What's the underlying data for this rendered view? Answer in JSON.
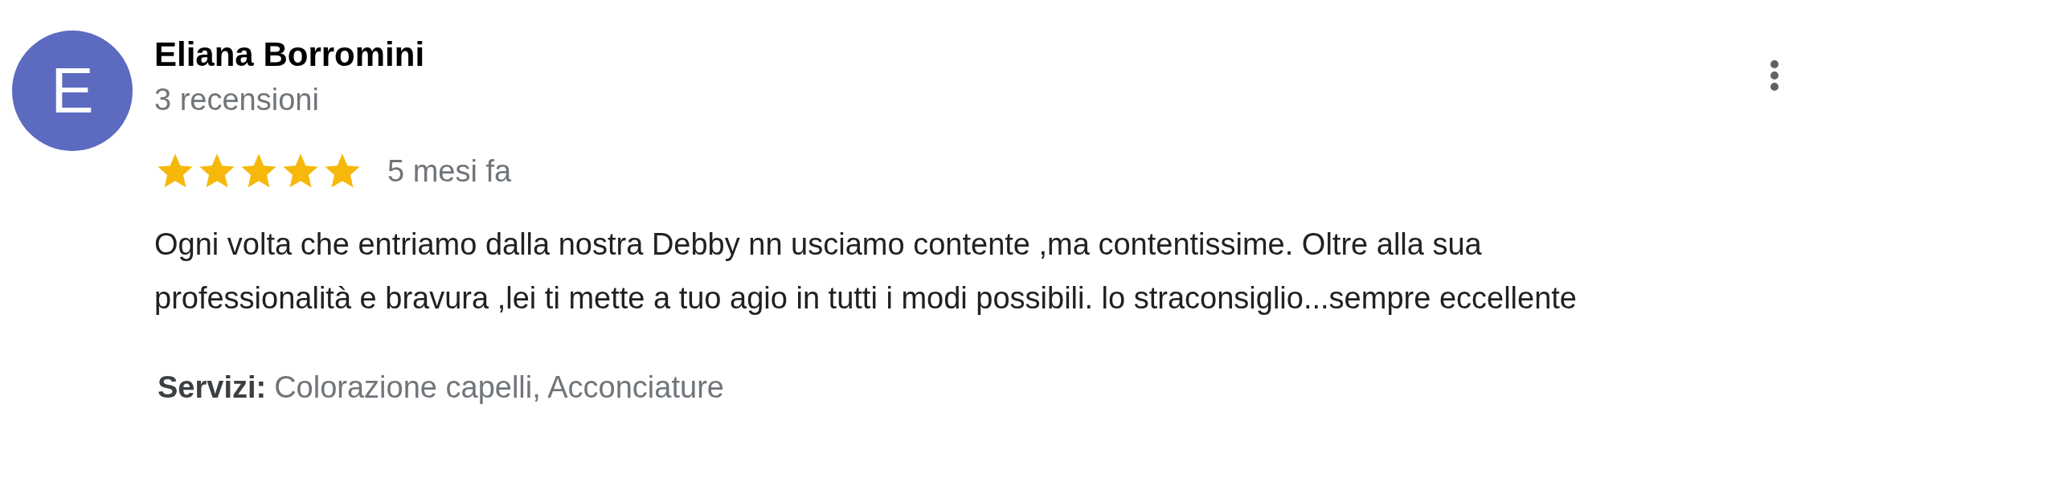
{
  "review": {
    "avatar_letter": "E",
    "author": "Eliana Borromini",
    "review_count": "3 recensioni",
    "stars": 5,
    "time": "5 mesi fa",
    "text": "Ogni volta che entriamo dalla nostra Debby nn usciamo contente ,ma contentissime. Oltre alla sua professionalità e bravura ,lei ti mette a tuo agio in tutti i modi possibili. lo straconsiglio...sempre eccellente",
    "services_label": "Servizi:",
    "services": "Colorazione capelli, Acconciature"
  }
}
